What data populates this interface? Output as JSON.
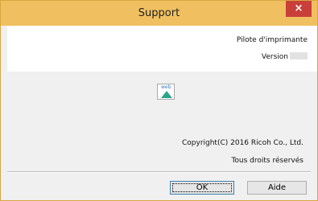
{
  "window": {
    "title": "Support",
    "close_symbol": "×"
  },
  "info": {
    "product": "Pilote d'imprimante",
    "version_label": "Version"
  },
  "web_icon": {
    "label": "web",
    "icon": "web-link-icon"
  },
  "footer": {
    "copyright": "Copyright(C) 2016 Ricoh Co., Ltd.",
    "rights": "Tous droits réservés"
  },
  "buttons": {
    "ok": "OK",
    "help": "Aide"
  },
  "colors": {
    "titlebar": "#f0c060",
    "close": "#c9403a",
    "dialog_bg": "#f0f0f0"
  }
}
